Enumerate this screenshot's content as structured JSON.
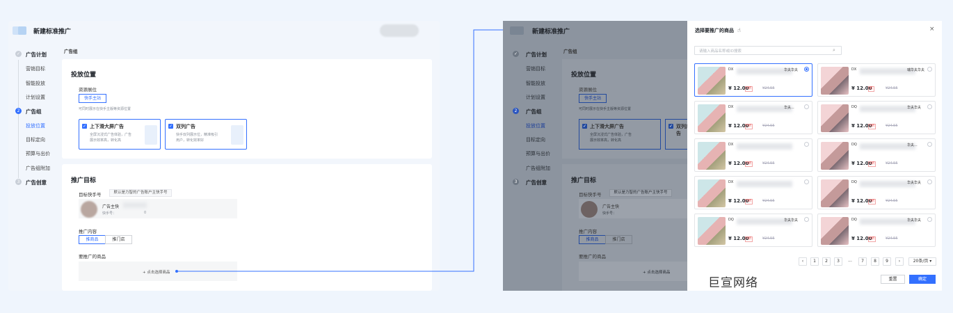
{
  "left": {
    "header_title": "新建标准推广",
    "nav": [
      {
        "type": "step",
        "label": "广告计划",
        "marker": "✓"
      },
      {
        "type": "item",
        "label": "营销目标"
      },
      {
        "type": "item",
        "label": "智能投放"
      },
      {
        "type": "item",
        "label": "计划设置"
      },
      {
        "type": "step",
        "label": "广告组",
        "marker": "2"
      },
      {
        "type": "item",
        "label": "投放位置",
        "active": true
      },
      {
        "type": "item",
        "label": "目标定向"
      },
      {
        "type": "item",
        "label": "预算与出价"
      },
      {
        "type": "item",
        "label": "广告组附加"
      },
      {
        "type": "step",
        "label": "广告创意",
        "marker": "3"
      }
    ],
    "breadcrumb": "广告组",
    "placement": {
      "title": "投放位置",
      "resource_label": "资源展位",
      "resource_value": "快手主站",
      "resource_hint": "可同时展示在快手主版等资源位置",
      "options": [
        {
          "title": "上下滑大屏广告",
          "desc1": "全屏沉浸式广告体验，广告",
          "desc2": "展示效率高，转化高"
        },
        {
          "title": "双列广告",
          "desc1": "快手双列展示位，精准吸引",
          "desc2": "用户，转化效率好"
        }
      ]
    },
    "target": {
      "title": "推广目标",
      "account_label": "目标快手号",
      "account_default": "默认是力智的广告账户主快手号",
      "account_name": "广告主快",
      "account_id": "快手号：",
      "account_id_tail": "0",
      "content_label": "推广内容",
      "content_tabs": [
        "推商品",
        "推门店"
      ],
      "goods_label": "要推广的商品",
      "goods_add": "+ 点击选择商品"
    }
  },
  "right": {
    "drawer_title": "选择要推广的商品",
    "search_placeholder": "请输入商品名称或ID搜索",
    "products": [
      {
        "code": "DX",
        "tail": "华夫华夫",
        "price": "¥ 12.00",
        "tag": "5折",
        "orig": "¥24.55",
        "selected": true
      },
      {
        "code": "DX",
        "tail": "瑞华夫华夫",
        "price": "¥ 12.00",
        "tag": "底",
        "orig": "¥24.55",
        "selected": false
      },
      {
        "code": "DX",
        "tail": "华夫...",
        "price": "¥ 12.00",
        "tag": "5折",
        "orig": "¥24.55",
        "selected": false
      },
      {
        "code": "DQ",
        "tail": "华夫华夫",
        "price": "¥ 12.00",
        "tag": "5折",
        "orig": "¥24.55",
        "selected": false
      },
      {
        "code": "DX",
        "tail": "",
        "price": "¥ 12.00",
        "tag": "5折",
        "orig": "¥24.55",
        "selected": false
      },
      {
        "code": "DQ",
        "tail": "华夫...",
        "price": "¥ 12.00",
        "tag": "5折",
        "orig": "¥24.55",
        "selected": false
      },
      {
        "code": "DX",
        "tail": "",
        "price": "¥ 12.00",
        "tag": "5折",
        "orig": "¥24.55",
        "selected": false
      },
      {
        "code": "DQ",
        "tail": "华夫华夫",
        "price": "¥ 12.00",
        "tag": "5折",
        "orig": "¥24.55",
        "selected": false
      },
      {
        "code": "DQ",
        "tail": "华夫华夫",
        "price": "¥ 12.00",
        "tag": "5折",
        "orig": "¥24.55",
        "selected": false
      },
      {
        "code": "DQ",
        "tail": "华夫华夫",
        "price": "¥ 12.00",
        "tag": "5折",
        "orig": "¥24.55",
        "selected": false
      }
    ],
    "pagination": [
      "‹",
      "1",
      "2",
      "3",
      "...",
      "7",
      "8",
      "9",
      "›"
    ],
    "page_size": "20条/页",
    "reset": "重置",
    "confirm": "确定",
    "watermark": "巨宣网络"
  },
  "colors": {
    "accent": "#3370ff",
    "bg": "#eff5fd",
    "dim": "#8c949f"
  }
}
